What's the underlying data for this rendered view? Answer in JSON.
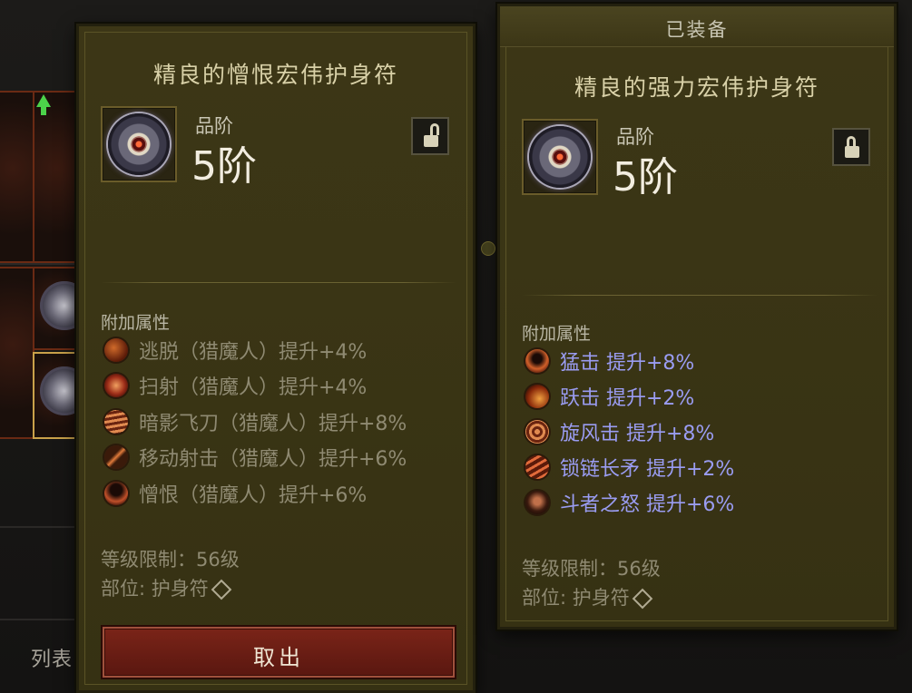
{
  "background": {
    "list_label": "列表"
  },
  "left_panel": {
    "item_name": "精良的憎恨宏伟护身符",
    "grade_label": "品阶",
    "grade_value": "5阶",
    "lock_state": "unlocked",
    "section_title": "附加属性",
    "attributes": [
      {
        "text": "逃脱（猎魔人）提升+4%",
        "icon": "escape-skill-icon"
      },
      {
        "text": "扫射（猎魔人）提升+4%",
        "icon": "strafe-skill-icon"
      },
      {
        "text": "暗影飞刀（猎魔人）提升+8%",
        "icon": "shadow-knife-skill-icon"
      },
      {
        "text": "移动射击（猎魔人）提升+6%",
        "icon": "moving-shot-skill-icon"
      },
      {
        "text": "憎恨（猎魔人）提升+6%",
        "icon": "hatred-skill-icon"
      }
    ],
    "level_req": "等级限制：56级",
    "slot": "部位: 护身符",
    "takeout_label": "取出"
  },
  "right_panel": {
    "equipped_label": "已装备",
    "item_name": "精良的强力宏伟护身符",
    "grade_label": "品阶",
    "grade_value": "5阶",
    "lock_state": "locked",
    "section_title": "附加属性",
    "attributes": [
      {
        "text": "猛击  提升+8%",
        "icon": "bash-skill-icon"
      },
      {
        "text": "跃击  提升+2%",
        "icon": "leap-skill-icon"
      },
      {
        "text": "旋风击  提升+8%",
        "icon": "whirlwind-skill-icon"
      },
      {
        "text": "锁链长矛  提升+2%",
        "icon": "chain-spear-skill-icon"
      },
      {
        "text": "斗者之怒  提升+6%",
        "icon": "wrath-skill-icon"
      }
    ],
    "level_req": "等级限制：56级",
    "slot": "部位: 护身符"
  },
  "colors": {
    "panel_bg": "#3a3515",
    "title_text": "#d9d1a8",
    "dim_attr": "#8f8a72",
    "active_attr": "#9a9cf2",
    "takeout_button": "#6a1d14"
  }
}
